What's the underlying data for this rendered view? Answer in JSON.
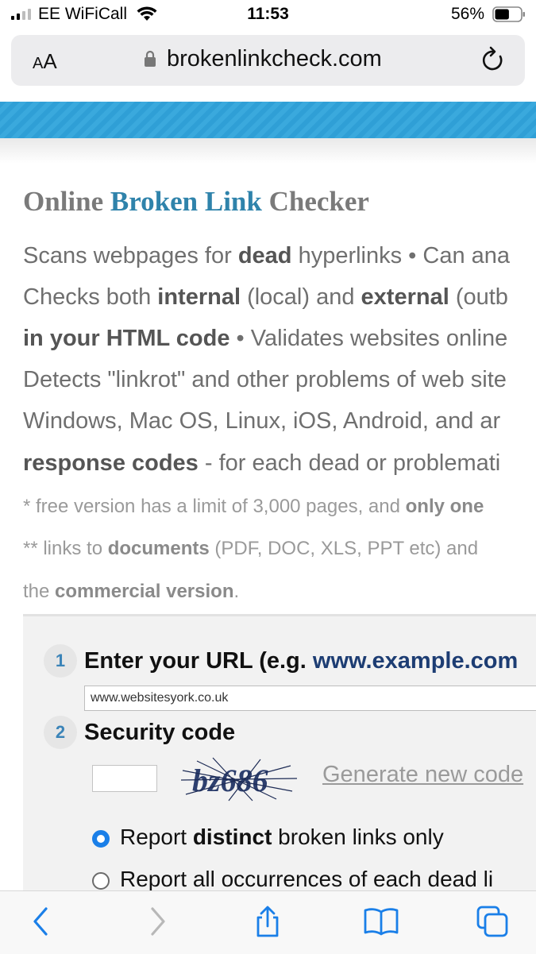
{
  "status": {
    "carrier": "EE WiFiCall",
    "time": "11:53",
    "battery_percent": "56%",
    "battery_level": 0.56,
    "icons": [
      "signal-icon",
      "wifi-icon",
      "battery-icon"
    ]
  },
  "browser": {
    "aa_large": "A",
    "aa_small": "A",
    "url": "brokenlinkcheck.com",
    "icons": [
      "lock-icon",
      "reload-icon"
    ]
  },
  "page": {
    "headline": {
      "part1": "Online ",
      "part2": "Broken Link",
      "part3": " Checker"
    },
    "description": [
      {
        "t1": "Scans webpages for ",
        "b1": "dead",
        "t2": " hyperlinks • Can ana"
      },
      {
        "t1": "Checks both ",
        "b1": "internal",
        "t2": " (local) and ",
        "b2": "external",
        "t3": " (outb"
      },
      {
        "b1": "in your HTML code",
        "t1": " • Validates websites online"
      },
      {
        "t1": "Detects \"linkrot\" and other problems of web site"
      },
      {
        "t1": "Windows, Mac OS, Linux, iOS, Android, and ar"
      },
      {
        "b1": "response codes",
        "t1": " - for each dead or problemati"
      }
    ],
    "notes": [
      {
        "t1": "*  free version has a limit of 3,000 pages, and ",
        "b1": "only one"
      },
      {
        "t1": "** links to ",
        "b1": "documents",
        "t2": " (PDF, DOC, XLS, PPT etc) and"
      },
      {
        "t1": "the ",
        "b1": "commercial version",
        "t2": "."
      }
    ]
  },
  "form": {
    "step1": {
      "number": "1",
      "title": "Enter your URL (e.g. ",
      "example": "www.example.com",
      "url_value": "www.websitesyork.co.uk"
    },
    "step2": {
      "number": "2",
      "title": "Security code",
      "captcha_text": "bz686",
      "generate_link": "Generate new code"
    },
    "options": [
      {
        "pre": "Report ",
        "bold": "distinct",
        "post": " broken links only",
        "selected": true
      },
      {
        "pre": "Report all occurrences of each dead li",
        "bold": "",
        "post": "",
        "selected": false
      }
    ]
  },
  "toolbar": {
    "icons": [
      "back-icon",
      "forward-icon",
      "share-icon",
      "bookmarks-icon",
      "tabs-icon"
    ]
  }
}
